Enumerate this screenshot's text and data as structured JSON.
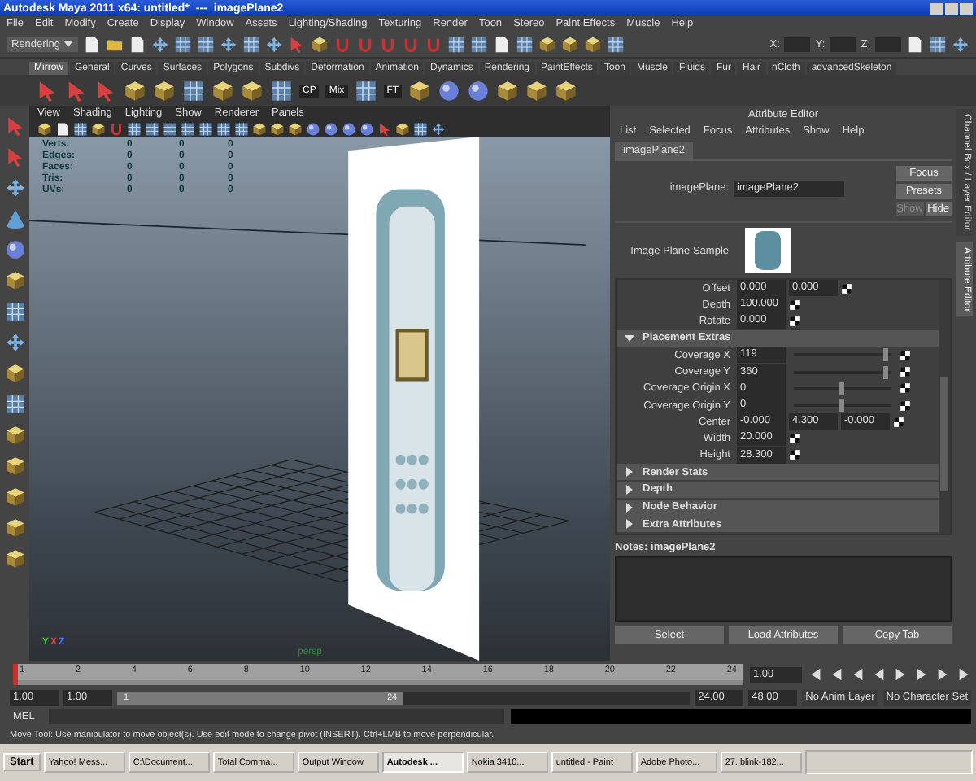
{
  "window": {
    "title": "Autodesk Maya 2011 x64: untitled*",
    "separator": "---",
    "subtitle": "imagePlane2"
  },
  "menu": [
    "File",
    "Edit",
    "Modify",
    "Create",
    "Display",
    "Window",
    "Assets",
    "Lighting/Shading",
    "Texturing",
    "Render",
    "Toon",
    "Stereo",
    "Paint Effects",
    "Muscle",
    "Help"
  ],
  "status_line": {
    "mode": "Rendering",
    "coords": [
      "X:",
      "Y:",
      "Z:"
    ]
  },
  "shelf": {
    "tabs": [
      {
        "label": "Mirrow",
        "selected": true
      },
      {
        "label": "General",
        "selected": false
      },
      {
        "label": "Curves",
        "selected": false
      },
      {
        "label": "Surfaces",
        "selected": false
      },
      {
        "label": "Polygons",
        "selected": false
      },
      {
        "label": "Subdivs",
        "selected": false
      },
      {
        "label": "Deformation",
        "selected": false
      },
      {
        "label": "Animation",
        "selected": false
      },
      {
        "label": "Dynamics",
        "selected": false
      },
      {
        "label": "Rendering",
        "selected": false
      },
      {
        "label": "PaintEffects",
        "selected": false
      },
      {
        "label": "Toon",
        "selected": false
      },
      {
        "label": "Muscle",
        "selected": false
      },
      {
        "label": "Fluids",
        "selected": false
      },
      {
        "label": "Fur",
        "selected": false
      },
      {
        "label": "Hair",
        "selected": false
      },
      {
        "label": "nCloth",
        "selected": false
      },
      {
        "label": "advancedSkeleton",
        "selected": false
      }
    ],
    "icon_labels": [
      "CP",
      "Mix",
      "FT"
    ]
  },
  "viewport": {
    "menu": [
      "View",
      "Shading",
      "Lighting",
      "Show",
      "Renderer",
      "Panels"
    ],
    "hud": [
      {
        "label": "Verts:",
        "values": [
          "0",
          "0",
          "0"
        ]
      },
      {
        "label": "Edges:",
        "values": [
          "0",
          "0",
          "0"
        ]
      },
      {
        "label": "Faces:",
        "values": [
          "0",
          "0",
          "0"
        ]
      },
      {
        "label": "Tris:",
        "values": [
          "0",
          "0",
          "0"
        ]
      },
      {
        "label": "UVs:",
        "values": [
          "0",
          "0",
          "0"
        ]
      }
    ],
    "axis": [
      "Y",
      "X",
      "Z"
    ],
    "camera_label": "persp"
  },
  "attribute_editor": {
    "title": "Attribute Editor",
    "menu": [
      "List",
      "Selected",
      "Focus",
      "Attributes",
      "Show",
      "Help"
    ],
    "tab": "imagePlane2",
    "node_label": "imagePlane:",
    "node_value": "imagePlane2",
    "buttons": [
      "Focus",
      "Presets"
    ],
    "show_hide": [
      {
        "label": "Show",
        "disabled": true
      },
      {
        "label": "Hide",
        "disabled": false
      }
    ],
    "sample_label": "Image Plane Sample",
    "rows": [
      {
        "kind": "fields",
        "label": "Offset",
        "values": [
          "0.000",
          "0.000"
        ]
      },
      {
        "kind": "fields",
        "label": "Depth",
        "values": [
          "100.000"
        ]
      },
      {
        "kind": "fields",
        "label": "Rotate",
        "values": [
          "0.000"
        ]
      },
      {
        "kind": "section",
        "label": "Placement Extras",
        "expanded": true
      },
      {
        "kind": "slider",
        "label": "Coverage X",
        "values": [
          "119"
        ],
        "level": 0.95
      },
      {
        "kind": "slider",
        "label": "Coverage Y",
        "values": [
          "360"
        ],
        "level": 0.95
      },
      {
        "kind": "slider",
        "label": "Coverage Origin X",
        "values": [
          "0"
        ],
        "level": 0.5
      },
      {
        "kind": "slider",
        "label": "Coverage Origin Y",
        "values": [
          "0"
        ],
        "level": 0.5
      },
      {
        "kind": "fields",
        "label": "Center",
        "values": [
          "-0.000",
          "4.300",
          "-0.000"
        ]
      },
      {
        "kind": "fields",
        "label": "Width",
        "values": [
          "20.000"
        ]
      },
      {
        "kind": "fields",
        "label": "Height",
        "values": [
          "28.300"
        ]
      },
      {
        "kind": "section",
        "label": "Render Stats",
        "expanded": false
      },
      {
        "kind": "section",
        "label": "Depth",
        "expanded": false
      },
      {
        "kind": "section",
        "label": "Node Behavior",
        "expanded": false
      },
      {
        "kind": "section",
        "label": "Extra Attributes",
        "expanded": false
      }
    ],
    "notes_label": "Notes: imagePlane2",
    "bottom_buttons": [
      "Select",
      "Load Attributes",
      "Copy Tab"
    ]
  },
  "side_tabs": [
    {
      "label": "Channel Box / Layer Editor",
      "selected": false
    },
    {
      "label": "Attribute Editor",
      "selected": true
    }
  ],
  "time_slider": {
    "current": "1",
    "level": 0,
    "ticks": [
      "2",
      "4",
      "6",
      "8",
      "10",
      "12",
      "14",
      "16",
      "18",
      "20",
      "22",
      "24"
    ],
    "current_field": "1.00"
  },
  "range_slider": {
    "start": "1.00",
    "range_start": "1.00",
    "bar_start": "1",
    "bar_end": "24",
    "level": 0.5,
    "range_end": "24.00",
    "end": "48.00",
    "anim_layer": "No Anim Layer",
    "character_set": "No Character Set"
  },
  "command_line": {
    "label": "MEL"
  },
  "help_line": "Move Tool: Use manipulator to move object(s). Use edit mode to change pivot (INSERT). Ctrl+LMB to move perpendicular.",
  "taskbar": {
    "start": "Start",
    "items": [
      {
        "label": "Yahoo! Mess...",
        "selected": false
      },
      {
        "label": "C:\\Document...",
        "selected": false
      },
      {
        "label": "Total Comma...",
        "selected": false
      },
      {
        "label": "Output Window",
        "selected": false
      },
      {
        "label": "Autodesk ...",
        "selected": true
      },
      {
        "label": "Nokia 3410...",
        "selected": false
      },
      {
        "label": "untitled - Paint",
        "selected": false
      },
      {
        "label": "Adobe Photo...",
        "selected": false
      },
      {
        "label": "27. blink-182...",
        "selected": false
      }
    ]
  }
}
